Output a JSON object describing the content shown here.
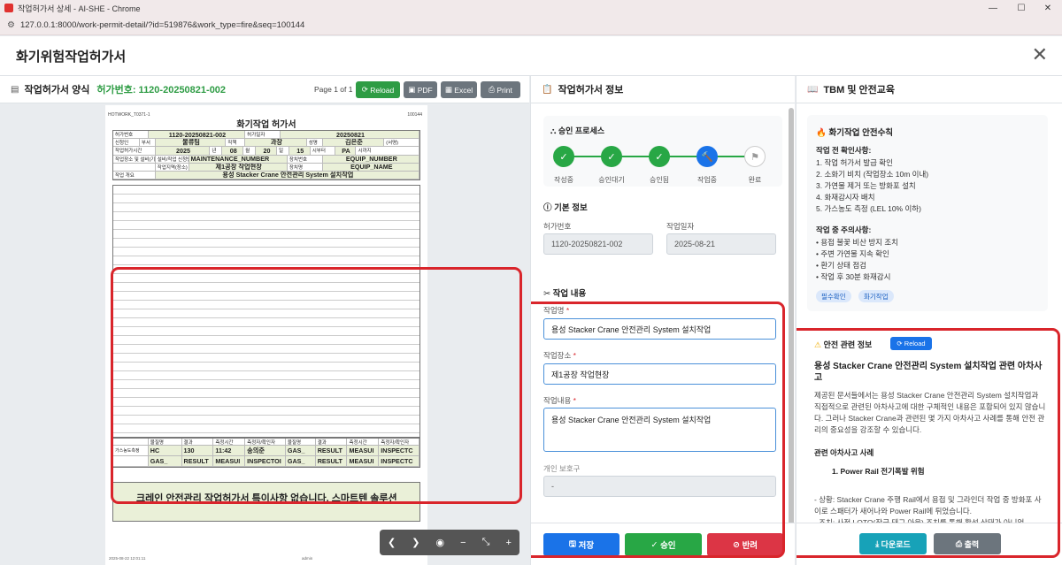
{
  "browser": {
    "tab_title": "작업허가서 상세 - AI-SHE - Chrome",
    "url": "127.0.0.1:8000/work-permit-detail/?id=519876&work_type=fire&seq=100144"
  },
  "modal": {
    "title": "화기위험작업허가서"
  },
  "left": {
    "header": "작업허가서 양식",
    "permit_label": "허가번호: 1120-20250821-002",
    "page_info": "Page 1 of 1",
    "buttons": {
      "reload": "Reload",
      "pdf": "PDF",
      "excel": "Excel",
      "print": "Print"
    },
    "doc": {
      "code_left": "HOTWORK_T0371-1",
      "code_right": "100144",
      "title": "화기작업 허가서",
      "rows": [
        [
          "허가번호",
          "1120-20250821-002",
          "허가일자",
          "20250821"
        ],
        [
          "신청인",
          "부서",
          "물류팀",
          "직책",
          "과장",
          "성명",
          "김은준",
          "(서명)"
        ],
        [
          "작업허가시간",
          "2025",
          "년",
          "08",
          "월",
          "20",
          "일",
          "15",
          "시부터",
          "PA",
          "시까지"
        ],
        [
          "작업장소 및 설비(기기)",
          "설비/작업 신청번호",
          "MAINTENANCE_NUMBER",
          "장치번호",
          "EQUIP_NUMBER"
        ],
        [
          "",
          "작업지역(장소)",
          "제1공장 작업현장",
          "장치명",
          "EQUIP_NAME"
        ],
        [
          "작업 개요",
          "용성 Stacker Crane 안전관리 System 설치작업"
        ]
      ],
      "gas_header": [
        "물질명",
        "결과",
        "측정시간",
        "측정자/확인자",
        "물질명",
        "결과",
        "측정시간",
        "측정자/확인자"
      ],
      "gas_row1": [
        "HC",
        "130",
        "11:42",
        "송의준",
        "GAS_",
        "RESULT",
        "MEASUI",
        "INSPECTC"
      ],
      "gas_row2": [
        "GAS_",
        "RESULT",
        "MEASUI",
        "INSPECTOI",
        "GAS_",
        "RESULT",
        "MEASUI",
        "INSPECTC"
      ],
      "memo": "크레인 안전관리 작업허가서 특이사항 없습니다. 스마트텐 솔루션",
      "foot_left": "2025-08-22 12:01:11",
      "foot_mid": "admin"
    },
    "viewer": {
      "prev": "❮",
      "next": "❯",
      "eye": "◉",
      "minus": "−",
      "fit": "⤡",
      "plus": "+"
    }
  },
  "middle": {
    "header": "작업허가서 정보",
    "approval": {
      "title": "승인 프로세스",
      "steps": [
        {
          "label": "작성중",
          "state": "done"
        },
        {
          "label": "승인대기",
          "state": "done"
        },
        {
          "label": "승인됨",
          "state": "done"
        },
        {
          "label": "작업중",
          "state": "active"
        },
        {
          "label": "완료",
          "state": "pending"
        }
      ]
    },
    "basic": {
      "title": "기본 정보",
      "permit_no_label": "허가번호",
      "permit_no": "1120-20250821-002",
      "date_label": "작업일자",
      "date": "2025-08-21"
    },
    "content": {
      "title": "작업 내용",
      "name_label": "작업명",
      "name": "용성 Stacker Crane 안전관리 System 설치작업",
      "place_label": "작업장소",
      "place": "제1공장 작업현장",
      "detail_label": "작업내용",
      "detail": "용성 Stacker Crane 안전관리 System 설치작업",
      "next_label": "개인 보호구",
      "next_value": "-"
    },
    "buttons": {
      "save": "저장",
      "approve": "승인",
      "reject": "반려"
    }
  },
  "right": {
    "header": "TBM 및 안전교육",
    "tbm": {
      "title": "화기작업 안전수칙",
      "before_title": "작업 전 확인사항:",
      "before": [
        "1. 작업 허가서 발급 확인",
        "2. 소화기 비치 (작업장소 10m 이내)",
        "3. 가연물 제거 또는 방화포 설치",
        "4. 화재감시자 배치",
        "5. 가스농도 측정 (LEL 10% 이하)"
      ],
      "during_title": "작업 중 주의사항:",
      "during": [
        "• 용접 불꽃 비산 방지 조치",
        "• 주변 가연물 지속 확인",
        "• 환기 상태 점검",
        "• 작업 후 30분 화재감시"
      ],
      "badges": [
        "필수확인",
        "화기작업"
      ]
    },
    "safety": {
      "title": "안전 관련 정보",
      "reload": "Reload",
      "heading": "용성 Stacker Crane 안전관리 System 설치작업 관련 아차사고",
      "para1": "제공된 문서들에서는 용성 Stacker Crane 안전관리 System 설치작업과 직접적으로 관련된 아차사고에 대한 구체적인 내용은 포함되어 있지 않습니다. 그러나 Stacker Crane과 관련된 몇 가지 아차사고 사례를 통해 안전 관리의 중요성을 강조할 수 있습니다.",
      "case_title": "관련 아차사고 사례",
      "case1": "1. Power Rail 전기폭발 위험",
      "para2": "- 상황: Stacker Crane 주행 Rail에서 용접 및 그라인더 작업 중 방화포 사이로 스패터가 새어나와 Power Rail에 튀었습니다.",
      "para3": "- 조치: 사전 LOTO(잠금 태그 아웃) 조치를 통해 활선 상태가 아니었"
    },
    "buttons": {
      "download": "다운로드",
      "print": "출력"
    }
  }
}
